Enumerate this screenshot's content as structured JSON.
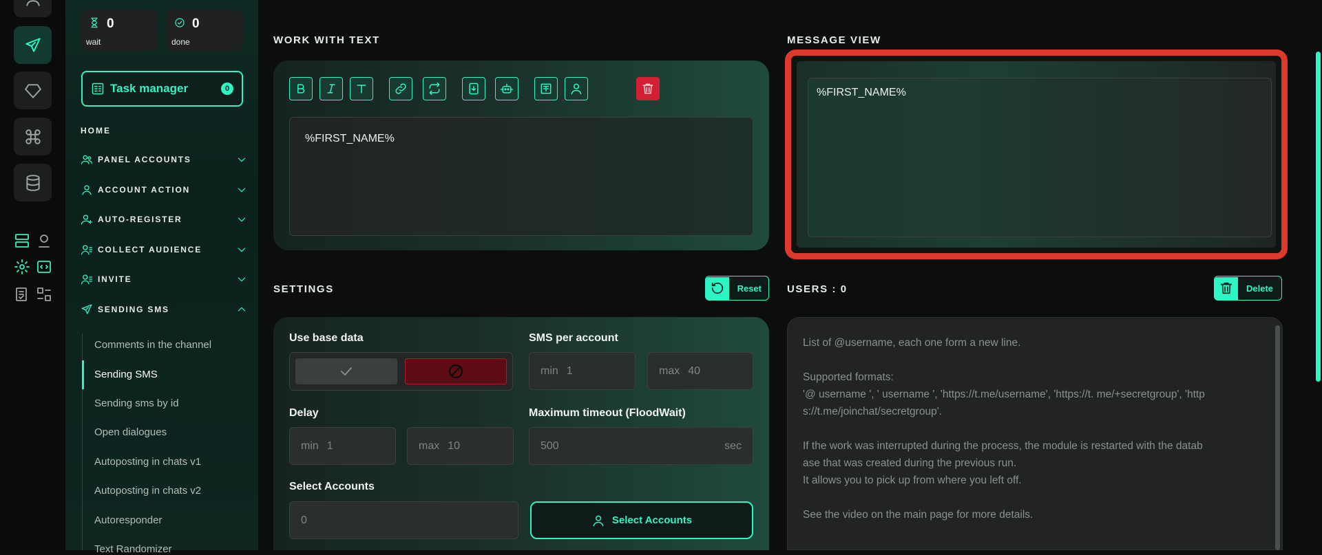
{
  "colors": {
    "accent": "#2ff5c4",
    "danger": "#d11f34",
    "highlight": "#dc3a2c",
    "sidebar_bg": "#0b211c"
  },
  "stats": [
    {
      "icon": "hourglass-icon",
      "value": "0",
      "label": "wait"
    },
    {
      "icon": "check-circle-icon",
      "value": "0",
      "label": "done"
    }
  ],
  "task_manager": {
    "label": "Task manager",
    "count": "0"
  },
  "nav": {
    "home": "HOME",
    "sections": [
      {
        "label": "PANEL ACCOUNTS",
        "icon": "users-icon",
        "expanded": false
      },
      {
        "label": "ACCOUNT ACTION",
        "icon": "user-icon",
        "expanded": false
      },
      {
        "label": "AUTO-REGISTER",
        "icon": "user-plus-icon",
        "expanded": false
      },
      {
        "label": "COLLECT AUDIENCE",
        "icon": "user-list-icon",
        "expanded": false
      },
      {
        "label": "INVITE",
        "icon": "user-list-icon",
        "expanded": false
      },
      {
        "label": "SENDING SMS",
        "icon": "send-icon",
        "expanded": true
      }
    ],
    "sub_items": [
      "Comments in the channel",
      "Sending SMS",
      "Sending sms by id",
      "Open dialogues",
      "Autoposting in chats v1",
      "Autoposting in chats v2",
      "Autoresponder",
      "Text Randomizer"
    ],
    "active_sub": "Sending SMS"
  },
  "work_with_text": {
    "title": "WORK WITH TEXT",
    "toolbar": [
      "bold-icon",
      "italic-icon",
      "text-icon",
      "link-icon",
      "repeat-icon",
      "insert-file-icon",
      "bot-icon",
      "template-icon",
      "user-variable-icon",
      "trash-icon"
    ],
    "editor_value": "%FIRST_NAME%"
  },
  "message_view": {
    "title": "MESSAGE VIEW",
    "text": "%FIRST_NAME%"
  },
  "settings": {
    "title": "SETTINGS",
    "reset_label": "Reset",
    "use_base_data": {
      "label": "Use base data",
      "selected": "off"
    },
    "sms_per_account": {
      "label": "SMS per account",
      "min_key": "min",
      "min": "1",
      "max_key": "max",
      "max": "40"
    },
    "delay": {
      "label": "Delay",
      "min_key": "min",
      "min": "1",
      "max_key": "max",
      "max": "10"
    },
    "flood_wait": {
      "label": "Maximum timeout (FloodWait)",
      "value": "500",
      "unit": "sec"
    },
    "select_accounts": {
      "label": "Select Accounts",
      "value": "0",
      "button": "Select Accounts"
    }
  },
  "users": {
    "title": "USERS : 0",
    "delete_label": "Delete",
    "placeholder_lines": [
      "List of @username, each one form a new line.",
      "",
      "Supported formats:",
      "'@ username ', ' username ', 'https://t.me/username', 'https://t. me/+secretgroup', 'http",
      "s://t.me/joinchat/secretgroup'.",
      "",
      "If the work was interrupted during the process, the module is restarted with the datab",
      "ase that was created during the previous run.",
      "It allows you to pick up from where you left off.",
      "",
      "See the video on the main page for more details."
    ]
  }
}
